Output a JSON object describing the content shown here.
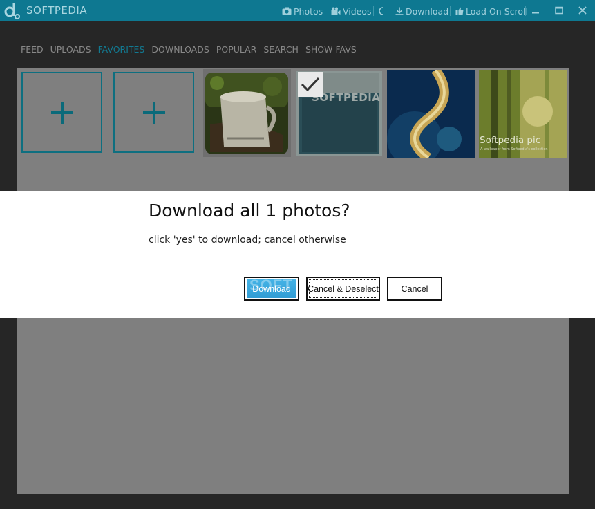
{
  "app": {
    "title": "SOFTPEDIA",
    "logo_icon": "softpedia-logo-icon"
  },
  "toolbar": {
    "photos_label": "Photos",
    "videos_label": "Videos",
    "download_label": "Download",
    "load_on_scroll_label": "Load On Scroll"
  },
  "nav": {
    "items": [
      {
        "label": "FEED",
        "active": false
      },
      {
        "label": "UPLOADS",
        "active": false
      },
      {
        "label": "FAVORITES",
        "active": true
      },
      {
        "label": "DOWNLOADS",
        "active": false
      },
      {
        "label": "POPULAR",
        "active": false
      },
      {
        "label": "SEARCH",
        "active": false
      },
      {
        "label": "SHOW FAVS",
        "active": false
      }
    ]
  },
  "gallery": {
    "add_symbol": "+",
    "thumb_text_1": "SOFTPEDIA",
    "thumb_caption": "Softpedia pic",
    "thumb_subcaption": "A wallpaper from Softpedia's collection"
  },
  "dialog": {
    "title": "Download all 1 photos?",
    "message": "click 'yes' to download; cancel otherwise",
    "download_button": "Download",
    "download_watermark": "SOFT",
    "deselect_button": "Cancel & Deselect",
    "cancel_button": "Cancel"
  },
  "colors": {
    "titlebar": "#0e7891",
    "accent": "#127a92",
    "download_button": "#3aa8de"
  }
}
